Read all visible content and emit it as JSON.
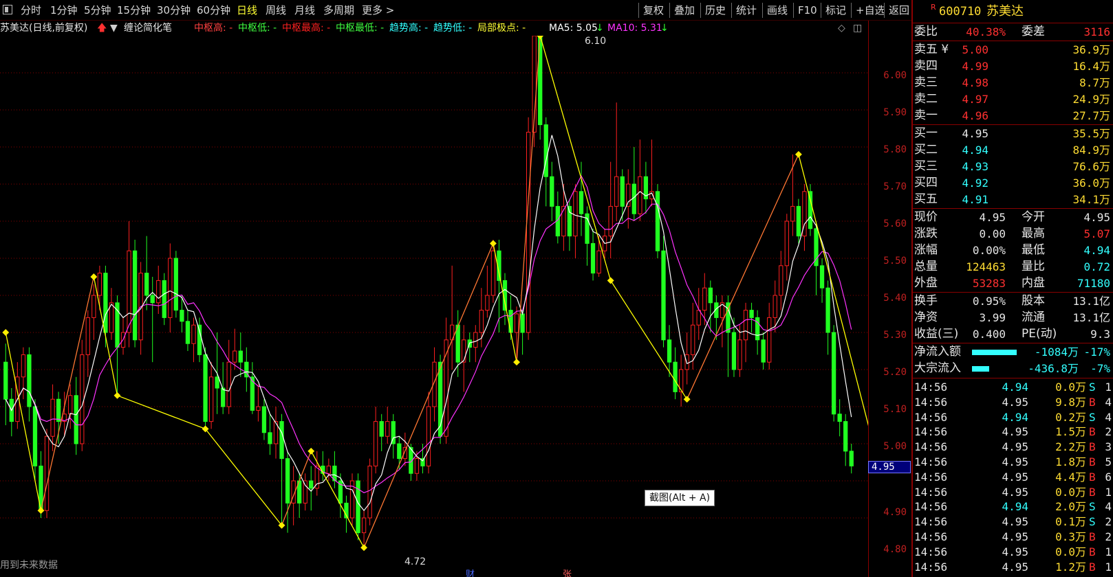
{
  "toolbar": {
    "periods": [
      "分时",
      "1分钟",
      "5分钟",
      "15分钟",
      "30分钟",
      "60分钟",
      "日线",
      "周线",
      "月线",
      "多周期",
      "更多 >"
    ],
    "active_period": "日线",
    "tools": [
      "复权",
      "叠加",
      "历史",
      "统计",
      "画线",
      "F10",
      "标记",
      "+自选",
      "返回"
    ]
  },
  "chart_header": {
    "title": "苏美达(日线,前复权)",
    "indicator": "缠论简化笔",
    "fields": [
      {
        "label": "中枢高: -",
        "color": "#ff4040"
      },
      {
        "label": "中枢低: -",
        "color": "#40ff40"
      },
      {
        "label": "中枢最高: -",
        "color": "#ff2020"
      },
      {
        "label": "中枢最低: -",
        "color": "#40ff40"
      },
      {
        "label": "趋势高: -",
        "color": "#33ffff"
      },
      {
        "label": "趋势低: -",
        "color": "#33ffff"
      },
      {
        "label": "局部极点: -",
        "color": "#ffff33"
      }
    ],
    "ma5": "MA5: 5.05",
    "ma10": "MA10: 5.31"
  },
  "y_ticks": [
    "6.00",
    "5.90",
    "5.80",
    "5.70",
    "5.60",
    "5.50",
    "5.40",
    "5.30",
    "5.20",
    "5.10",
    "5.00",
    "4.90",
    "4.80"
  ],
  "current_price_tag": "4.95",
  "high_label": "6.10",
  "low_label": "4.72",
  "footer_note": "用到未来数据",
  "marker_cai": "财",
  "marker_zhang": "张",
  "tooltip": "截图(Alt + A)",
  "panel": {
    "code": "600710",
    "name": "苏美达",
    "r_mark": "R",
    "wei_bi_label": "委比",
    "wei_bi": "40.38%",
    "wei_cha_label": "委差",
    "wei_cha": "3116",
    "asks": [
      {
        "label": "卖五 ¥",
        "price": "5.00",
        "vol": "36.9万"
      },
      {
        "label": "卖四",
        "price": "4.99",
        "vol": "16.4万"
      },
      {
        "label": "卖三",
        "price": "4.98",
        "vol": "8.7万"
      },
      {
        "label": "卖二",
        "price": "4.97",
        "vol": "24.9万"
      },
      {
        "label": "卖一",
        "price": "4.96",
        "vol": "27.7万"
      }
    ],
    "bids": [
      {
        "label": "买一",
        "price": "4.95",
        "vol": "35.5万",
        "color": "white"
      },
      {
        "label": "买二",
        "price": "4.94",
        "vol": "84.9万",
        "color": "cyan"
      },
      {
        "label": "买三",
        "price": "4.93",
        "vol": "76.6万",
        "color": "cyan"
      },
      {
        "label": "买四",
        "price": "4.92",
        "vol": "36.0万",
        "color": "cyan"
      },
      {
        "label": "买五",
        "price": "4.91",
        "vol": "34.1万",
        "color": "cyan"
      }
    ],
    "stats": [
      {
        "l1": "现价",
        "v1": "4.95",
        "c1": "white",
        "l2": "今开",
        "v2": "4.95",
        "c2": "white"
      },
      {
        "l1": "涨跌",
        "v1": "0.00",
        "c1": "white",
        "l2": "最高",
        "v2": "5.07",
        "c2": "red"
      },
      {
        "l1": "涨幅",
        "v1": "0.00%",
        "c1": "white",
        "l2": "最低",
        "v2": "4.94",
        "c2": "cyan"
      },
      {
        "l1": "总量",
        "v1": "124463",
        "c1": "yellow",
        "l2": "量比",
        "v2": "0.72",
        "c2": "cyan"
      },
      {
        "l1": "外盘",
        "v1": "53283",
        "c1": "red",
        "l2": "内盘",
        "v2": "71180",
        "c2": "cyan"
      }
    ],
    "stats2": [
      {
        "l1": "换手",
        "v1": "0.95%",
        "c1": "white",
        "l2": "股本",
        "v2": "13.1亿",
        "c2": "white"
      },
      {
        "l1": "净资",
        "v1": "3.99",
        "c1": "white",
        "l2": "流通",
        "v2": "13.1亿",
        "c2": "white"
      },
      {
        "l1": "收益(三)",
        "v1": "0.400",
        "c1": "white",
        "l2": "PE(动)",
        "v2": "9.3",
        "c2": "white"
      }
    ],
    "flows": [
      {
        "label": "净流入额",
        "value": "-1084万",
        "pct": "-17%",
        "bar": 0.9
      },
      {
        "label": "大宗流入",
        "value": "-436.8万",
        "pct": "-7%",
        "bar": 0.35
      }
    ],
    "ticks": [
      {
        "time": "14:56",
        "price": "4.94",
        "pc": "cyan",
        "vol": "0.0万",
        "bs": "S",
        "n": "1"
      },
      {
        "time": "14:56",
        "price": "4.95",
        "pc": "white",
        "vol": "9.8万",
        "bs": "B",
        "n": "4"
      },
      {
        "time": "14:56",
        "price": "4.94",
        "pc": "cyan",
        "vol": "0.2万",
        "bs": "S",
        "n": "4"
      },
      {
        "time": "14:56",
        "price": "4.95",
        "pc": "white",
        "vol": "1.5万",
        "bs": "B",
        "n": "2"
      },
      {
        "time": "14:56",
        "price": "4.95",
        "pc": "white",
        "vol": "2.2万",
        "bs": "B",
        "n": "3"
      },
      {
        "time": "14:56",
        "price": "4.95",
        "pc": "white",
        "vol": "1.8万",
        "bs": "B",
        "n": "5"
      },
      {
        "time": "14:56",
        "price": "4.95",
        "pc": "white",
        "vol": "4.4万",
        "bs": "B",
        "n": "6"
      },
      {
        "time": "14:56",
        "price": "4.95",
        "pc": "white",
        "vol": "0.0万",
        "bs": "B",
        "n": "1"
      },
      {
        "time": "14:56",
        "price": "4.94",
        "pc": "cyan",
        "vol": "2.0万",
        "bs": "S",
        "n": "4"
      },
      {
        "time": "14:56",
        "price": "4.95",
        "pc": "white",
        "vol": "0.1万",
        "bs": "S",
        "n": "2"
      },
      {
        "time": "14:56",
        "price": "4.95",
        "pc": "white",
        "vol": "0.3万",
        "bs": "B",
        "n": "2"
      },
      {
        "time": "14:56",
        "price": "4.95",
        "pc": "white",
        "vol": "0.0万",
        "bs": "B",
        "n": "1"
      },
      {
        "time": "14:56",
        "price": "4.95",
        "pc": "white",
        "vol": "1.2万",
        "bs": "B",
        "n": "1"
      }
    ]
  },
  "candles": [
    [
      5.22,
      5.12,
      5.27,
      5.05
    ],
    [
      5.12,
      5.06,
      5.15,
      5.02
    ],
    [
      5.06,
      5.18,
      5.22,
      5.04
    ],
    [
      5.18,
      5.24,
      5.26,
      5.12
    ],
    [
      5.24,
      5.1,
      5.26,
      5.06
    ],
    [
      5.1,
      4.94,
      5.12,
      4.9
    ],
    [
      4.94,
      4.82,
      4.98,
      4.8
    ],
    [
      4.82,
      5.02,
      5.04,
      4.8
    ],
    [
      5.02,
      5.12,
      5.16,
      4.98
    ],
    [
      5.12,
      5.06,
      5.14,
      5.0
    ],
    [
      5.06,
      5.08,
      5.14,
      5.02
    ],
    [
      5.08,
      5.13,
      5.16,
      5.04
    ],
    [
      5.13,
      5.0,
      5.18,
      4.97
    ],
    [
      5.0,
      5.24,
      5.28,
      4.98
    ],
    [
      5.24,
      5.34,
      5.36,
      5.18
    ],
    [
      5.34,
      5.4,
      5.43,
      5.28
    ],
    [
      5.4,
      5.46,
      5.48,
      5.36
    ],
    [
      5.46,
      5.3,
      5.48,
      5.26
    ],
    [
      5.3,
      5.38,
      5.42,
      5.28
    ],
    [
      5.38,
      5.26,
      5.4,
      5.13
    ],
    [
      5.26,
      5.3,
      5.34,
      5.24
    ],
    [
      5.3,
      5.52,
      5.6,
      5.26
    ],
    [
      5.52,
      5.28,
      5.55,
      5.26
    ],
    [
      5.28,
      5.46,
      5.49,
      5.24
    ],
    [
      5.46,
      5.4,
      5.56,
      5.36
    ],
    [
      5.4,
      5.38,
      5.45,
      5.22
    ],
    [
      5.38,
      5.44,
      5.48,
      5.35
    ],
    [
      5.44,
      5.34,
      5.46,
      5.32
    ],
    [
      5.34,
      5.5,
      5.54,
      5.3
    ],
    [
      5.5,
      5.36,
      5.52,
      5.34
    ],
    [
      5.36,
      5.33,
      5.4,
      5.3
    ],
    [
      5.33,
      5.27,
      5.36,
      5.25
    ],
    [
      5.27,
      5.32,
      5.34,
      5.22
    ],
    [
      5.32,
      5.24,
      5.34,
      5.22
    ],
    [
      5.24,
      5.06,
      5.26,
      5.04
    ],
    [
      5.06,
      5.18,
      5.22,
      5.04
    ],
    [
      5.18,
      5.15,
      5.3,
      5.08
    ],
    [
      5.15,
      5.1,
      5.22,
      5.08
    ],
    [
      5.1,
      5.22,
      5.28,
      5.08
    ],
    [
      5.22,
      5.25,
      5.31,
      5.2
    ],
    [
      5.25,
      5.22,
      5.3,
      5.18
    ],
    [
      5.22,
      5.18,
      5.26,
      5.14
    ],
    [
      5.18,
      5.09,
      5.22,
      5.08
    ],
    [
      5.09,
      5.1,
      5.16,
      5.06
    ],
    [
      5.1,
      5.03,
      5.12,
      5.01
    ],
    [
      5.03,
      5.0,
      5.08,
      4.97
    ],
    [
      5.0,
      5.06,
      5.1,
      4.96
    ],
    [
      5.06,
      4.96,
      5.08,
      4.78
    ],
    [
      4.96,
      4.84,
      4.98,
      4.76
    ],
    [
      4.84,
      4.9,
      4.94,
      4.78
    ],
    [
      4.9,
      4.84,
      4.92,
      4.8
    ],
    [
      4.84,
      4.9,
      4.92,
      4.82
    ],
    [
      4.9,
      4.88,
      4.94,
      4.82
    ],
    [
      4.88,
      4.94,
      4.98,
      4.86
    ],
    [
      4.94,
      4.92,
      4.98,
      4.9
    ],
    [
      4.92,
      4.94,
      4.96,
      4.9
    ],
    [
      4.94,
      4.9,
      4.98,
      4.88
    ],
    [
      4.9,
      4.84,
      4.92,
      4.8
    ],
    [
      4.84,
      4.8,
      4.86,
      4.76
    ],
    [
      4.8,
      4.9,
      4.92,
      4.78
    ],
    [
      4.9,
      4.76,
      4.92,
      4.74
    ],
    [
      4.76,
      4.8,
      4.82,
      4.72
    ],
    [
      4.8,
      4.94,
      4.96,
      4.78
    ],
    [
      4.94,
      5.06,
      5.1,
      4.92
    ],
    [
      5.06,
      5.02,
      5.08,
      4.98
    ],
    [
      5.02,
      5.06,
      5.1,
      5.0
    ],
    [
      5.06,
      5.0,
      5.08,
      4.96
    ],
    [
      5.0,
      4.96,
      5.02,
      4.93
    ],
    [
      4.96,
      4.99,
      5.03,
      4.94
    ],
    [
      4.99,
      4.92,
      5.0,
      4.9
    ],
    [
      4.92,
      4.96,
      4.98,
      4.9
    ],
    [
      4.96,
      4.94,
      5.0,
      4.92
    ],
    [
      4.94,
      5.1,
      5.14,
      4.92
    ],
    [
      5.1,
      5.22,
      5.26,
      5.06
    ],
    [
      5.22,
      5.02,
      5.24,
      5.0
    ],
    [
      5.02,
      5.28,
      5.34,
      5.0
    ],
    [
      5.28,
      5.32,
      5.48,
      5.2
    ],
    [
      5.32,
      5.22,
      5.36,
      5.18
    ],
    [
      5.22,
      5.28,
      5.32,
      5.14
    ],
    [
      5.28,
      5.26,
      5.3,
      5.22
    ],
    [
      5.26,
      5.3,
      5.32,
      5.22
    ],
    [
      5.3,
      5.36,
      5.42,
      5.26
    ],
    [
      5.36,
      5.4,
      5.48,
      5.34
    ],
    [
      5.4,
      5.52,
      5.55,
      5.38
    ],
    [
      5.52,
      5.44,
      5.55,
      5.3
    ],
    [
      5.44,
      5.36,
      5.46,
      5.32
    ],
    [
      5.36,
      5.3,
      5.4,
      5.28
    ],
    [
      5.3,
      5.35,
      5.37,
      5.22
    ],
    [
      5.35,
      5.3,
      5.36,
      5.24
    ],
    [
      5.3,
      5.84,
      5.88,
      5.28
    ],
    [
      5.84,
      6.1,
      6.1,
      5.8
    ],
    [
      6.1,
      5.86,
      6.1,
      5.82
    ],
    [
      5.86,
      5.72,
      5.88,
      5.64
    ],
    [
      5.72,
      5.64,
      5.76,
      5.6
    ],
    [
      5.64,
      5.56,
      5.68,
      5.54
    ],
    [
      5.56,
      5.64,
      5.7,
      5.52
    ],
    [
      5.64,
      5.56,
      5.66,
      5.52
    ],
    [
      5.56,
      5.68,
      5.7,
      5.5
    ],
    [
      5.68,
      5.62,
      5.76,
      5.56
    ],
    [
      5.62,
      5.54,
      5.64,
      5.48
    ],
    [
      5.54,
      5.46,
      5.58,
      5.44
    ],
    [
      5.46,
      5.52,
      5.56,
      5.45
    ],
    [
      5.52,
      5.56,
      5.58,
      5.5
    ],
    [
      5.56,
      5.64,
      5.76,
      5.5
    ],
    [
      5.64,
      5.72,
      5.92,
      5.6
    ],
    [
      5.72,
      5.64,
      5.74,
      5.6
    ],
    [
      5.64,
      5.7,
      5.74,
      5.58
    ],
    [
      5.7,
      5.62,
      5.8,
      5.6
    ],
    [
      5.62,
      5.72,
      5.82,
      5.6
    ],
    [
      5.72,
      5.66,
      5.76,
      5.62
    ],
    [
      5.66,
      5.68,
      5.82,
      5.64
    ],
    [
      5.68,
      5.52,
      5.7,
      5.5
    ],
    [
      5.52,
      5.28,
      5.56,
      5.26
    ],
    [
      5.28,
      5.22,
      5.32,
      5.18
    ],
    [
      5.22,
      5.14,
      5.26,
      5.12
    ],
    [
      5.14,
      5.2,
      5.24,
      5.1
    ],
    [
      5.2,
      5.24,
      5.3,
      5.16
    ],
    [
      5.24,
      5.32,
      5.38,
      5.2
    ],
    [
      5.32,
      5.36,
      5.42,
      5.28
    ],
    [
      5.36,
      5.42,
      5.46,
      5.32
    ],
    [
      5.42,
      5.38,
      5.44,
      5.3
    ],
    [
      5.38,
      5.34,
      5.4,
      5.28
    ],
    [
      5.34,
      5.38,
      5.4,
      5.26
    ],
    [
      5.38,
      5.3,
      5.4,
      5.18
    ],
    [
      5.3,
      5.2,
      5.34,
      5.18
    ],
    [
      5.2,
      5.28,
      5.32,
      5.18
    ],
    [
      5.28,
      5.36,
      5.38,
      5.22
    ],
    [
      5.36,
      5.34,
      5.38,
      5.3
    ],
    [
      5.34,
      5.28,
      5.36,
      5.24
    ],
    [
      5.28,
      5.22,
      5.3,
      5.2
    ],
    [
      5.22,
      5.34,
      5.38,
      5.2
    ],
    [
      5.34,
      5.4,
      5.44,
      5.3
    ],
    [
      5.4,
      5.48,
      5.52,
      5.36
    ],
    [
      5.48,
      5.6,
      5.62,
      5.44
    ],
    [
      5.6,
      5.64,
      5.78,
      5.56
    ],
    [
      5.64,
      5.56,
      5.66,
      5.54
    ],
    [
      5.56,
      5.68,
      5.7,
      5.52
    ],
    [
      5.68,
      5.58,
      5.7,
      5.56
    ],
    [
      5.58,
      5.48,
      5.6,
      5.4
    ],
    [
      5.48,
      5.42,
      5.5,
      5.38
    ],
    [
      5.42,
      5.3,
      5.44,
      5.24
    ],
    [
      5.3,
      5.08,
      5.32,
      5.06
    ],
    [
      5.08,
      5.06,
      5.12,
      5.02
    ],
    [
      5.06,
      4.98,
      5.08,
      4.94
    ],
    [
      4.98,
      4.94,
      5.0,
      4.92
    ]
  ],
  "bi_points": [
    [
      0,
      5.3
    ],
    [
      6,
      4.82
    ],
    [
      15,
      5.45
    ],
    [
      19,
      5.13
    ],
    [
      34,
      5.04
    ],
    [
      47,
      4.78
    ],
    [
      52,
      4.98
    ],
    [
      61,
      4.72
    ],
    [
      83,
      5.54
    ],
    [
      87,
      5.22
    ],
    [
      91,
      6.1
    ],
    [
      103,
      5.44
    ],
    [
      116,
      5.12
    ],
    [
      135,
      5.78
    ],
    [
      149,
      4.92
    ]
  ],
  "colors": {
    "up": "#ff2020",
    "down": "#20ff20",
    "ma5": "#ffffff",
    "ma10": "#ff33ff",
    "bi_up": "#ff7733",
    "bi_down": "#ffff00",
    "grid": "#8a0000"
  }
}
